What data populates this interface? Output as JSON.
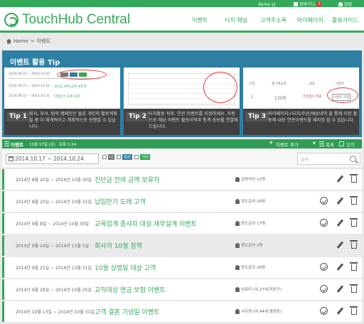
{
  "topbar": {
    "user": "demo 님",
    "cart_label": "장바구니",
    "cart_count": "3",
    "alarm_label": "알림"
  },
  "header": {
    "logo": "TouchHub Central",
    "nav": [
      "이벤트",
      "터치 채널",
      "고객주소록",
      "마이페이지",
      "활용가이드"
    ]
  },
  "breadcrumb": {
    "home": "Home",
    "sep": ">",
    "current": "이벤트"
  },
  "tips": {
    "title": "이벤트 활용 Tip",
    "cards": [
      {
        "label": "Tip 1",
        "text": "회사, 부서, 팀의 캠페인은 물론 개인의 활동계획을 좀 더 체계적이고 계획적으로 진행할 수 있습니다."
      },
      {
        "label": "Tip 2",
        "text": "터치활동 직후, 연관 이벤트를 지정하세요. 자동으로 해당 이벤트 활동이력과 통계 정보를 연결해 드립니다."
      },
      {
        "label": "Tip 3",
        "text": "마이페이지>터치/주문/배송내역 을 통해 이전 활동에 대한 연관이벤트를 재지정 할 수 있습니다."
      }
    ],
    "mini1": {
      "range": "2014.09.25 ~ 2014.10.02",
      "r1d": "2014.09.22 ~ 2014.10.31",
      "r1t": "진단금 잔여 금액 보유자",
      "r2d": "2014.09.22 ~ 2014.10.31",
      "r2t": "납입만기 도래 고객"
    },
    "mini3": {
      "h1": "고객",
      "h2": "총구매금액",
      "h3": "상태",
      "h4": "이벤트",
      "v1": "1",
      "v2": "130원",
      "v3": "주문접수 완료",
      "v4": "이벤트 지정"
    }
  },
  "toolbar": {
    "list_label": "이벤트",
    "date_label": "10월 17일 (금)",
    "time_label": "오후 5:24",
    "add_label": "이벤트 추가",
    "list_view": "목록",
    "calendar_view": "달력"
  },
  "filter": {
    "range": "2014.10.17 ~ 2014.10.24",
    "chk1": "나",
    "chk2": "회사",
    "chk3": "기타",
    "search_placeholder": "검색"
  },
  "colors": {
    "accent": "#34a95a",
    "tip_bg": "#2e7fa4",
    "tag_company": "#2e7fa4",
    "tag_other": "#34a95a"
  },
  "events": [
    {
      "date": "2014년 8월 20일 ~ 2014년 10월 30일",
      "title": "진단금 잔여 금액 보유자",
      "owner": "김영석외 12명",
      "has_check": false
    },
    {
      "date": "2014년 8월 20일 ~ 2014년 10월 31일",
      "title": "납입만기 도래 고객",
      "owner": "장도준외 26명",
      "has_check": true
    },
    {
      "date": "2014년 9월 8일 ~ 2014년 10월 30일",
      "title": "교육업계 종사자 대상 재무설계 이벤트",
      "owner": "장도준외 17명",
      "has_check": true
    },
    {
      "date": "2014년 9월 24일 ~ 2014년 11월 5일",
      "title": "회사의 10월 정책",
      "owner": "장도준외 2명",
      "has_check": false
    },
    {
      "date": "2014년 9월 25일 ~ 2014년 10월 31일",
      "title": "10월 상령일 대상 고객",
      "owner": "장도준외 26명",
      "has_check": true
    },
    {
      "date": "2014년 9월 29일 ~ 2014년 10월 25일",
      "title": "교직대상 연금 보험 이벤트",
      "owner": "성유미 (여,27세,미포구)",
      "has_check": true
    },
    {
      "date": "2014년 10월 13일 ~ 2014년 10월 31일",
      "title": "고객 결혼 기념일 이벤트",
      "owner": "서지영 (여,44세,명창동)",
      "has_check": true
    }
  ]
}
